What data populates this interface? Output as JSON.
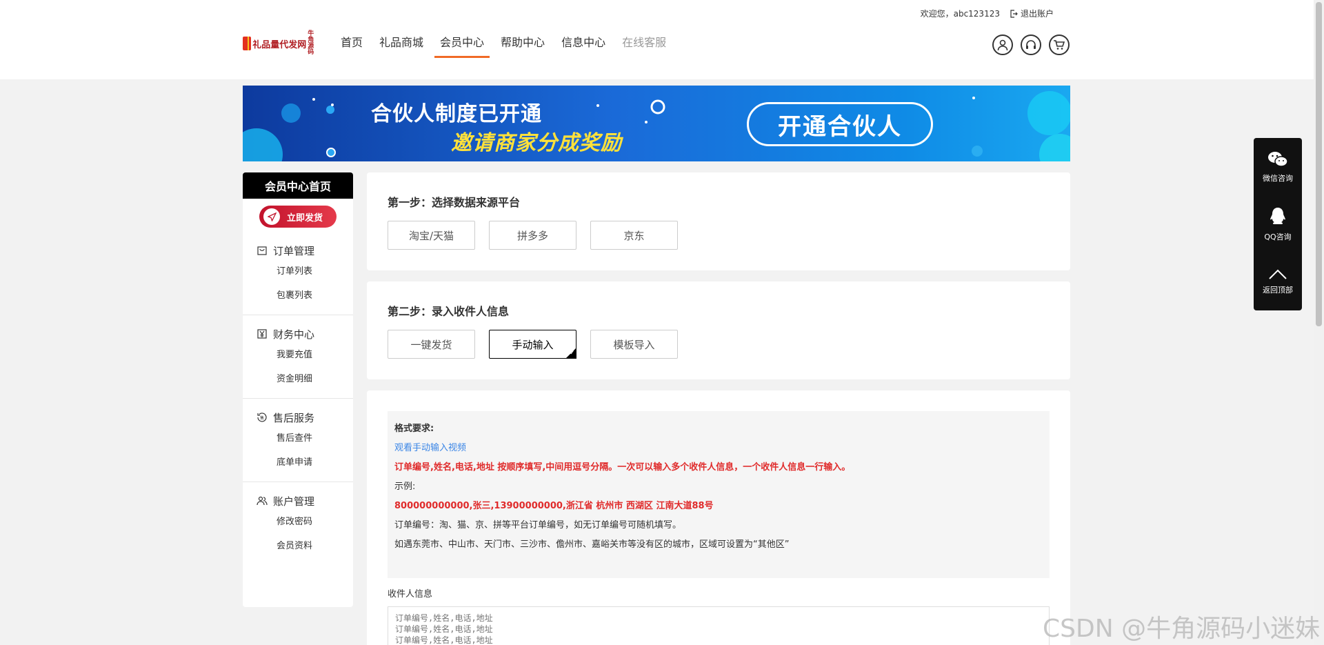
{
  "header": {
    "welcome": "欢迎您，abc123123",
    "logout": "退出账户",
    "logo_text": "礼品量代发网",
    "logo_badge": "牛角源码",
    "nav": [
      {
        "label": "首页"
      },
      {
        "label": "礼品商城"
      },
      {
        "label": "会员中心"
      },
      {
        "label": "帮助中心"
      },
      {
        "label": "信息中心"
      },
      {
        "label": "在线客服"
      }
    ],
    "icons": [
      "user-icon",
      "headset-icon",
      "cart-icon"
    ]
  },
  "banner": {
    "line1": "合伙人制度已开通",
    "line2": "邀请商家分成奖励",
    "cta": "开通合伙人"
  },
  "sidebar": {
    "head": "会员中心首页",
    "ship_button": "立即发货",
    "groups": [
      {
        "title": "订单管理",
        "icon": "bag-icon",
        "items": [
          "订单列表",
          "包裹列表"
        ]
      },
      {
        "title": "财务中心",
        "icon": "yen-icon",
        "items": [
          "我要充值",
          "资金明细"
        ]
      },
      {
        "title": "售后服务",
        "icon": "service-icon",
        "items": [
          "售后查件",
          "底单申请"
        ]
      },
      {
        "title": "账户管理",
        "icon": "users-icon",
        "items": [
          "修改密码",
          "会员资料"
        ]
      }
    ]
  },
  "step1": {
    "title": "第一步：选择数据来源平台",
    "options": [
      "淘宝/天猫",
      "拼多多",
      "京东"
    ]
  },
  "step2": {
    "title": "第二步：录入收件人信息",
    "options": [
      "一键发货",
      "手动输入",
      "模板导入"
    ],
    "selected": 1
  },
  "format": {
    "heading": "格式要求:",
    "video_link": "观看手动输入视频",
    "rule": "订单编号,姓名,电话,地址 按顺序填写,中间用逗号分隔。一次可以输入多个收件人信息，一个收件人信息一行输入。",
    "example_label": "示例:",
    "example": "800000000000,张三,13900000000,浙江省 杭州市 西湖区 江南大道88号",
    "note1": "订单编号：淘、猫、京、拼等平台订单编号，如无订单编号可随机填写。",
    "note2": "如遇东莞市、中山市、天门市、三沙市、儋州市、嘉峪关市等没有区的城市，区域可设置为“其他区”"
  },
  "recipient": {
    "label": "收件人信息",
    "placeholder": "订单编号,姓名,电话,地址\n订单编号,姓名,电话,地址\n订单编号,姓名,电话,地址"
  },
  "float_bar": [
    {
      "label": "微信咨询",
      "icon": "wechat-icon"
    },
    {
      "label": "QQ咨询",
      "icon": "qq-icon"
    },
    {
      "label": "返回顶部",
      "icon": "arrow-up-icon"
    }
  ],
  "watermark": "CSDN @牛角源码小迷妹"
}
